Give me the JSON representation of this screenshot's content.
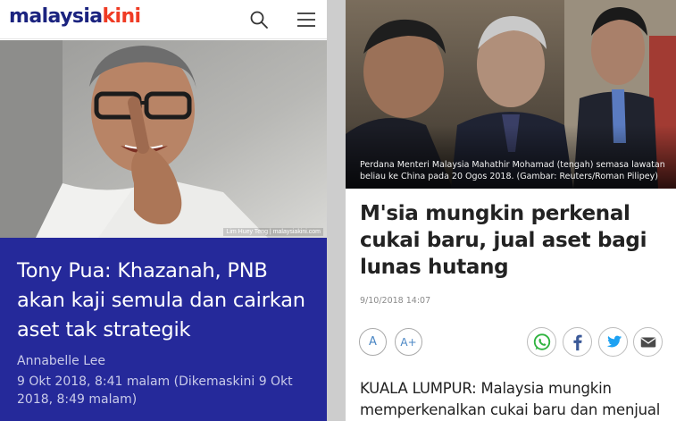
{
  "left": {
    "logo_part1": "malaysia",
    "logo_part2": "kini",
    "icons": {
      "search": "search-icon",
      "menu": "hamburger-menu-icon"
    },
    "photo_credit": "Lim Huey Teng | malaysiakini.com",
    "title": "Tony Pua: Khazanah, PNB akan kaji semula dan cairkan aset tak strategik",
    "author": "Annabelle Lee",
    "date": "9 Okt 2018, 8:41 malam (Dikemaskini 9 Okt 2018, 8:49 malam)",
    "colors": {
      "header_bg": "#25299a",
      "logo_blue": "#1b237f",
      "logo_red": "#ef3b24"
    }
  },
  "right": {
    "caption": "Perdana Menteri Malaysia Mahathir Mohamad (tengah) semasa lawatan beliau ke China pada 20 Ogos 2018. (Gambar: Reuters/Roman Pilipey)",
    "title": "M'sia mungkin perkenal cukai baru, jual aset bagi lunas hutang",
    "date": "9/10/2018 14:07",
    "font_small": "A",
    "font_large": "A+",
    "share": {
      "whatsapp": "whatsapp-icon",
      "facebook": "facebook-icon",
      "twitter": "twitter-icon",
      "email": "email-icon"
    },
    "body": "KUALA LUMPUR: Malaysia mungkin memperkenalkan cukai baru dan menjual",
    "colors": {
      "whatsapp": "#2fb33f",
      "facebook": "#3b5998",
      "twitter": "#1da1f2",
      "email": "#4a4a4a"
    }
  }
}
